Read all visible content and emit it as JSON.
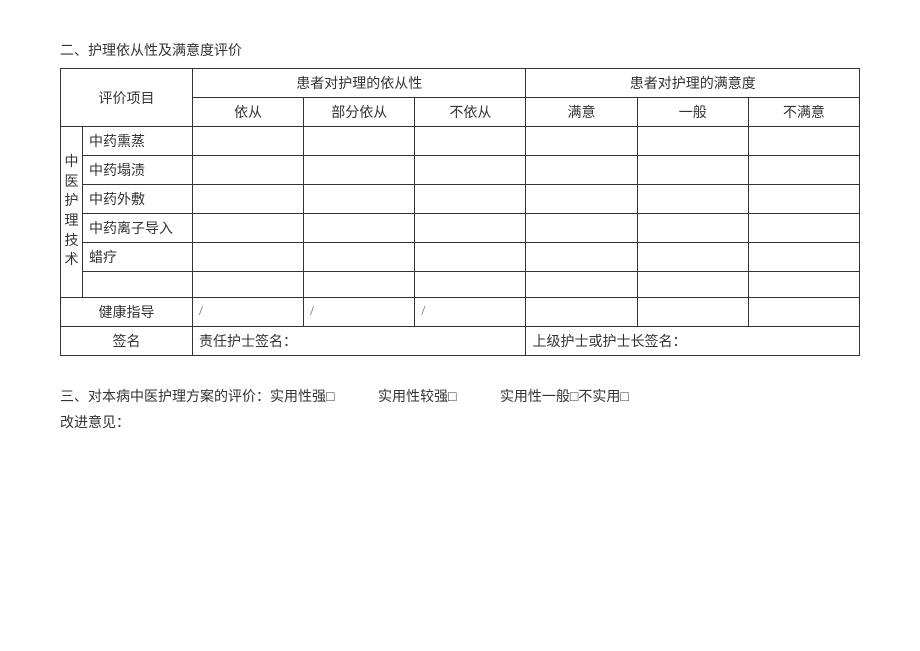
{
  "section2": {
    "title": "二、护理依从性及满意度评价",
    "header": {
      "eval_item": "评价项目",
      "compliance_group": "患者对护理的依从性",
      "satisfaction_group": "患者对护理的满意度",
      "compliance_yes": "依从",
      "compliance_partial": "部分依从",
      "compliance_no": "不依从",
      "satisfaction_yes": "满意",
      "satisfaction_mid": "一般",
      "satisfaction_no": "不满意"
    },
    "tech_group_label": "中医护理技术",
    "tech_items": [
      "中药熏蒸",
      "中药塌渍",
      "中药外敷",
      "中药离子导入",
      "蜡疗",
      ""
    ],
    "health_guidance_label": "健康指导",
    "slash": "/",
    "signature_label": "签名",
    "duty_nurse_signature": "责任护士签名：",
    "senior_nurse_signature": "上级护士或护士长签名："
  },
  "section3": {
    "prefix": "三、对本病中医护理方案的评价：",
    "options": {
      "strong": "实用性强□",
      "fair_strong": "实用性较强□",
      "average_none": "实用性一般□不实用□"
    },
    "suggestion": "改进意见："
  }
}
